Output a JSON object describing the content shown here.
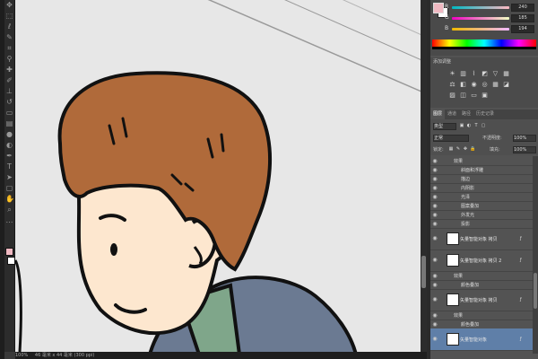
{
  "colors": {
    "foreground": "#f0b9c2",
    "background": "#ffffff",
    "hair": "#b06a3a",
    "skin": "#fde7cf",
    "shirt": "#7fa68a",
    "jacket": "#6b7a92",
    "canvas": "#e7e7e7",
    "selection": "#5f7fa8"
  },
  "color_panel": {
    "channels": [
      {
        "label": "R",
        "value": "240"
      },
      {
        "label": "G",
        "value": "185"
      },
      {
        "label": "B",
        "value": "194"
      }
    ]
  },
  "adjustments": {
    "title": "添加调整",
    "icons": [
      "sun-icon",
      "levels-icon",
      "curves-icon",
      "exposure-icon",
      "triangle-icon",
      "hue-icon",
      "balance-icon",
      "bw-icon",
      "camera-icon",
      "mixer-icon",
      "grid-icon",
      "invert-icon",
      "posterize-icon",
      "threshold-icon",
      "gradient-icon",
      "selective-icon"
    ]
  },
  "tabs": [
    "图层",
    "通道",
    "路径",
    "历史记录"
  ],
  "layer_controls": {
    "kind": "类型",
    "blend": "正常",
    "opacity_label": "不透明度:",
    "opacity": "100%",
    "lock_label": "锁定:",
    "fill_label": "填充:",
    "fill": "100%"
  },
  "layers": [
    {
      "type": "group",
      "name": "效果"
    },
    {
      "type": "effect",
      "name": "斜面和浮雕"
    },
    {
      "type": "effect",
      "name": "描边"
    },
    {
      "type": "effect",
      "name": "内阴影"
    },
    {
      "type": "effect",
      "name": "光泽"
    },
    {
      "type": "effect",
      "name": "图案叠加"
    },
    {
      "type": "effect",
      "name": "外发光"
    },
    {
      "type": "effect",
      "name": "投影"
    },
    {
      "type": "layer",
      "name": "矢量智能对象 拷贝"
    },
    {
      "type": "layer",
      "name": "矢量智能对象 拷贝 2"
    },
    {
      "type": "group",
      "name": "效果"
    },
    {
      "type": "effect",
      "name": "颜色叠加"
    },
    {
      "type": "layer",
      "name": "矢量智能对象 拷贝"
    },
    {
      "type": "group",
      "name": "效果"
    },
    {
      "type": "effect",
      "name": "颜色叠加"
    },
    {
      "type": "layer",
      "name": "矢量智能对象",
      "selected": true
    }
  ],
  "status": {
    "zoom": "100%",
    "doc": "46 毫米 x 44 毫米 (300 ppi)"
  }
}
